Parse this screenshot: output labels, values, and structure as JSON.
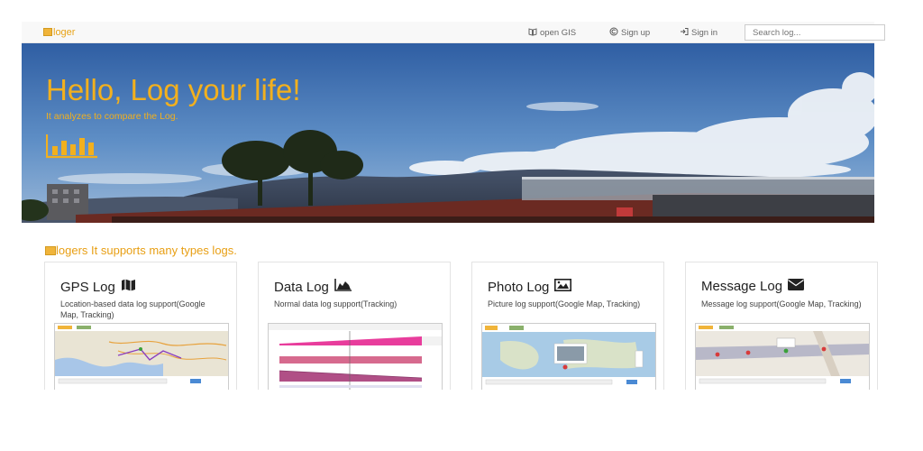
{
  "navbar": {
    "brand": "loger",
    "links": [
      {
        "icon": "book-icon",
        "label": "open GIS"
      },
      {
        "icon": "copyright-icon",
        "label": "Sign up"
      },
      {
        "icon": "sign-in-icon",
        "label": "Sign in"
      }
    ],
    "search_placeholder": "Search log..."
  },
  "hero": {
    "title": "Hello, Log your life!",
    "subtitle": "It analyzes to compare the Log.",
    "icon": "bar-chart-icon",
    "accent_color": "#f2b01e"
  },
  "section": {
    "brand": "logers",
    "title": " It supports many types logs."
  },
  "cards": [
    {
      "title": "GPS Log",
      "icon": "map-icon",
      "description": "Location-based data log support(Google Map, Tracking)"
    },
    {
      "title": "Data Log",
      "icon": "area-chart-icon",
      "description": "Normal data log support(Tracking)"
    },
    {
      "title": "Photo Log",
      "icon": "picture-icon",
      "description": "Picture log support(Google Map, Tracking)"
    },
    {
      "title": "Message Log",
      "icon": "envelope-icon",
      "description": "Message log support(Google Map, Tracking)"
    }
  ]
}
